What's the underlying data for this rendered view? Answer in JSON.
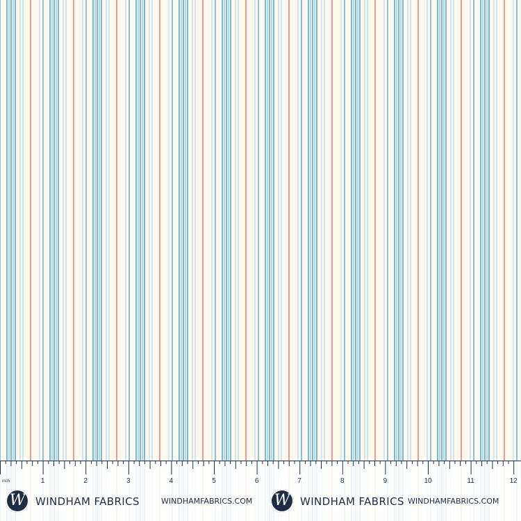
{
  "fabric": {
    "background_color": "#fdf9ee",
    "stripe_colors": {
      "blue": "#3b9fd4",
      "light_blue": "#8cc9e8",
      "coral": "#ef7f7f"
    }
  },
  "ruler": {
    "unit_label": "inch",
    "numbers": [
      "1",
      "2",
      "3",
      "4",
      "5",
      "6",
      "7",
      "8",
      "9",
      "10",
      "11",
      "12"
    ],
    "color": "#1e2c44"
  },
  "branding": [
    {
      "logo_letter": "W",
      "name": "WINDHAM FABRICS",
      "url": "WINDHAMFABRICS.COM"
    },
    {
      "logo_letter": "W",
      "name": "WINDHAM FABRICS",
      "url": "WINDHAMFABRICS.COM"
    }
  ]
}
